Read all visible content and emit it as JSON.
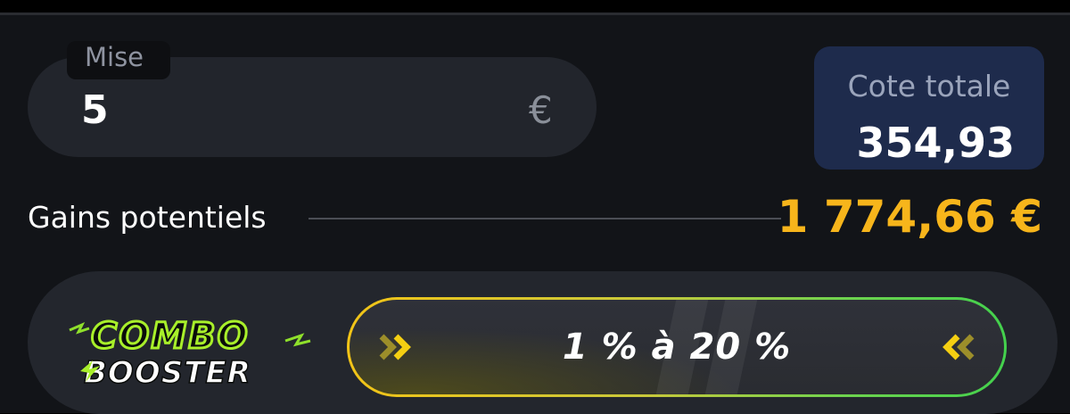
{
  "stake": {
    "label": "Mise",
    "value": "5",
    "currency": "€"
  },
  "odds": {
    "label": "Cote totale",
    "value": "354,93"
  },
  "gains": {
    "label": "Gains potentiels",
    "value": "1 774,66 €"
  },
  "booster": {
    "logo_line1": "COMBO",
    "logo_line2": "BOOSTER",
    "range_text": "1 % à 20 %",
    "left_icon": "chevrons-right-icon",
    "right_icon": "chevrons-left-icon"
  },
  "colors": {
    "accent_gold": "#f7b51b",
    "odds_box": "#1e2b4c",
    "booster_green": "#43d14d",
    "booster_yellow": "#f2c417"
  }
}
